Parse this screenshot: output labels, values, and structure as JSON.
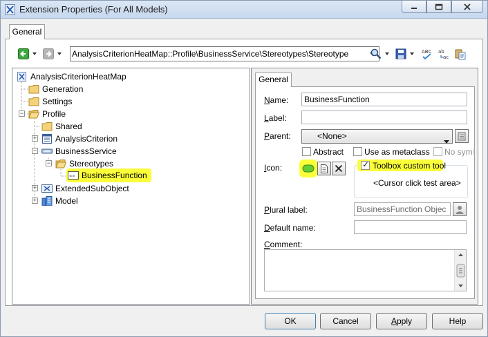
{
  "window": {
    "title": "Extension Properties (For All Models)",
    "minimize_icon": "minimize-icon",
    "maximize_icon": "restore-icon",
    "close_icon": "close-icon"
  },
  "outer_tab": {
    "label": "General"
  },
  "toolbar": {
    "path": "AnalysisCriterionHeatMap::Profile\\BusinessService\\Stereotypes\\Stereotype",
    "icons": [
      "back-arrow-icon",
      "forward-arrow-icon",
      "find-icon",
      "save-icon",
      "spell-check-icon",
      "replace-icon",
      "paste-icon"
    ]
  },
  "tree": {
    "root": "AnalysisCriterionHeatMap",
    "items": [
      {
        "label": "Generation"
      },
      {
        "label": "Settings"
      },
      {
        "label": "Profile"
      },
      {
        "label": "Shared"
      },
      {
        "label": "AnalysisCriterion"
      },
      {
        "label": "BusinessService"
      },
      {
        "label": "Stereotypes"
      },
      {
        "label": "BusinessFunction"
      },
      {
        "label": "ExtendedSubObject"
      },
      {
        "label": "Model"
      }
    ]
  },
  "inner_tab": {
    "label": "General"
  },
  "form": {
    "name_label": "Name:",
    "name_value": "BusinessFunction",
    "label_label": "Label:",
    "label_value": "",
    "parent_label": "Parent:",
    "parent_value": "<None>",
    "abstract_label": "Abstract",
    "abstract_checked": false,
    "metaclass_label": "Use as metaclass",
    "metaclass_checked": false,
    "nosymbol_label": "No symb",
    "nosymbol_checked": false,
    "icon_label": "Icon:",
    "toolbox_label": "Toolbox custom tool",
    "toolbox_checked": true,
    "cursor_text": "<Cursor click test area>",
    "plural_label": "Plural label:",
    "plural_value": "BusinessFunction Objec",
    "default_name_label": "Default name:",
    "default_name_value": "",
    "comment_label": "Comment:",
    "comment_value": ""
  },
  "buttons": {
    "ok": "OK",
    "cancel": "Cancel",
    "apply": "Apply",
    "help": "Help"
  },
  "colors": {
    "highlight": "#fbff3a",
    "icon_green": "#66cc33"
  }
}
